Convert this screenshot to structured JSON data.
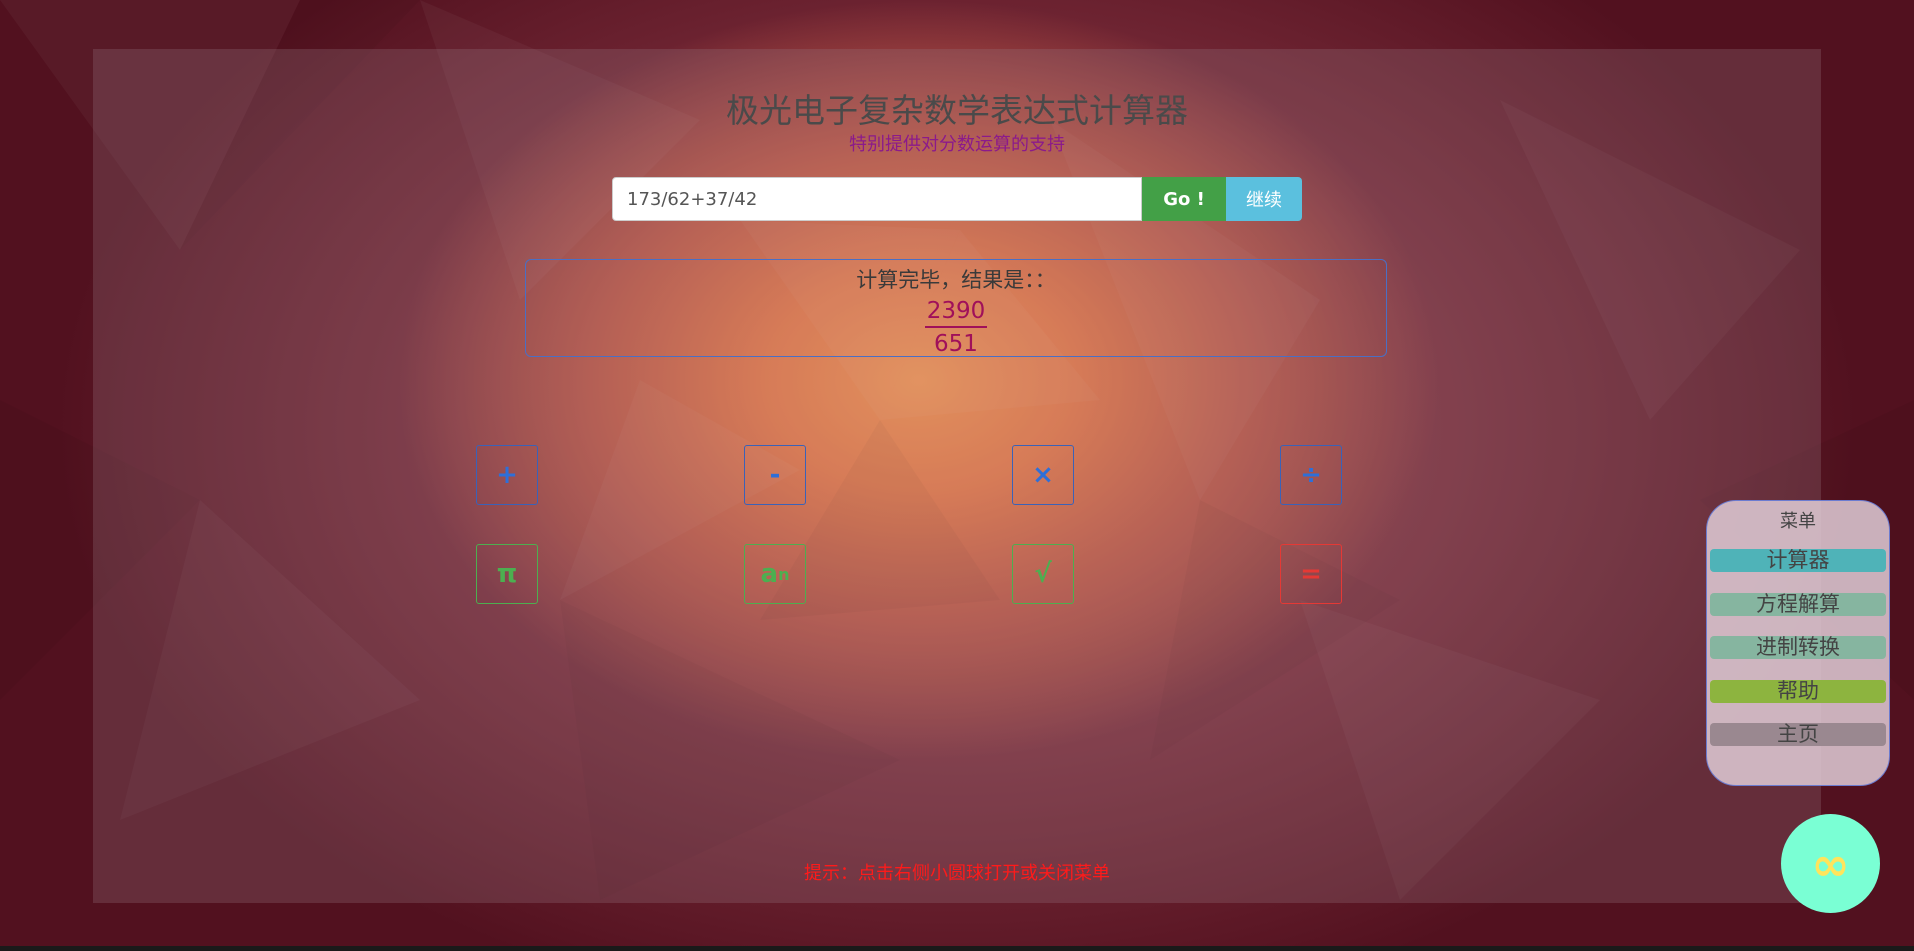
{
  "title": "极光电子复杂数学表达式计算器",
  "subtitle": "特别提供对分数运算的支持",
  "expression": {
    "value": "173/62+37/42",
    "go_label": "Go !",
    "continue_label": "继续"
  },
  "result": {
    "label": "计算完毕，结果是：：",
    "numerator": "2390",
    "denominator": "651"
  },
  "keys": {
    "plus": "+",
    "minus": "-",
    "times": "×",
    "divide": "÷",
    "pi": "π",
    "power_base": "a",
    "power_exp": "n",
    "sqrt": "√",
    "equals": "="
  },
  "hint": "提示：点击右侧小圆球打开或关闭菜单",
  "menu": {
    "title": "菜单",
    "items": [
      {
        "label": "计算器",
        "color": "#4fb3b8"
      },
      {
        "label": "方程解算",
        "color": "#86b5a0"
      },
      {
        "label": "进制转换",
        "color": "#86b5a0"
      },
      {
        "label": "帮助",
        "color": "#8db43f"
      },
      {
        "label": "主页",
        "color": "#9a8890"
      }
    ]
  },
  "fab": {
    "icon": "infinity-icon",
    "glyph": "∞"
  },
  "colors": {
    "go": "#43a047",
    "continue": "#5bc0de",
    "result_text": "#a0105a",
    "hint": "#ff1a1a"
  }
}
